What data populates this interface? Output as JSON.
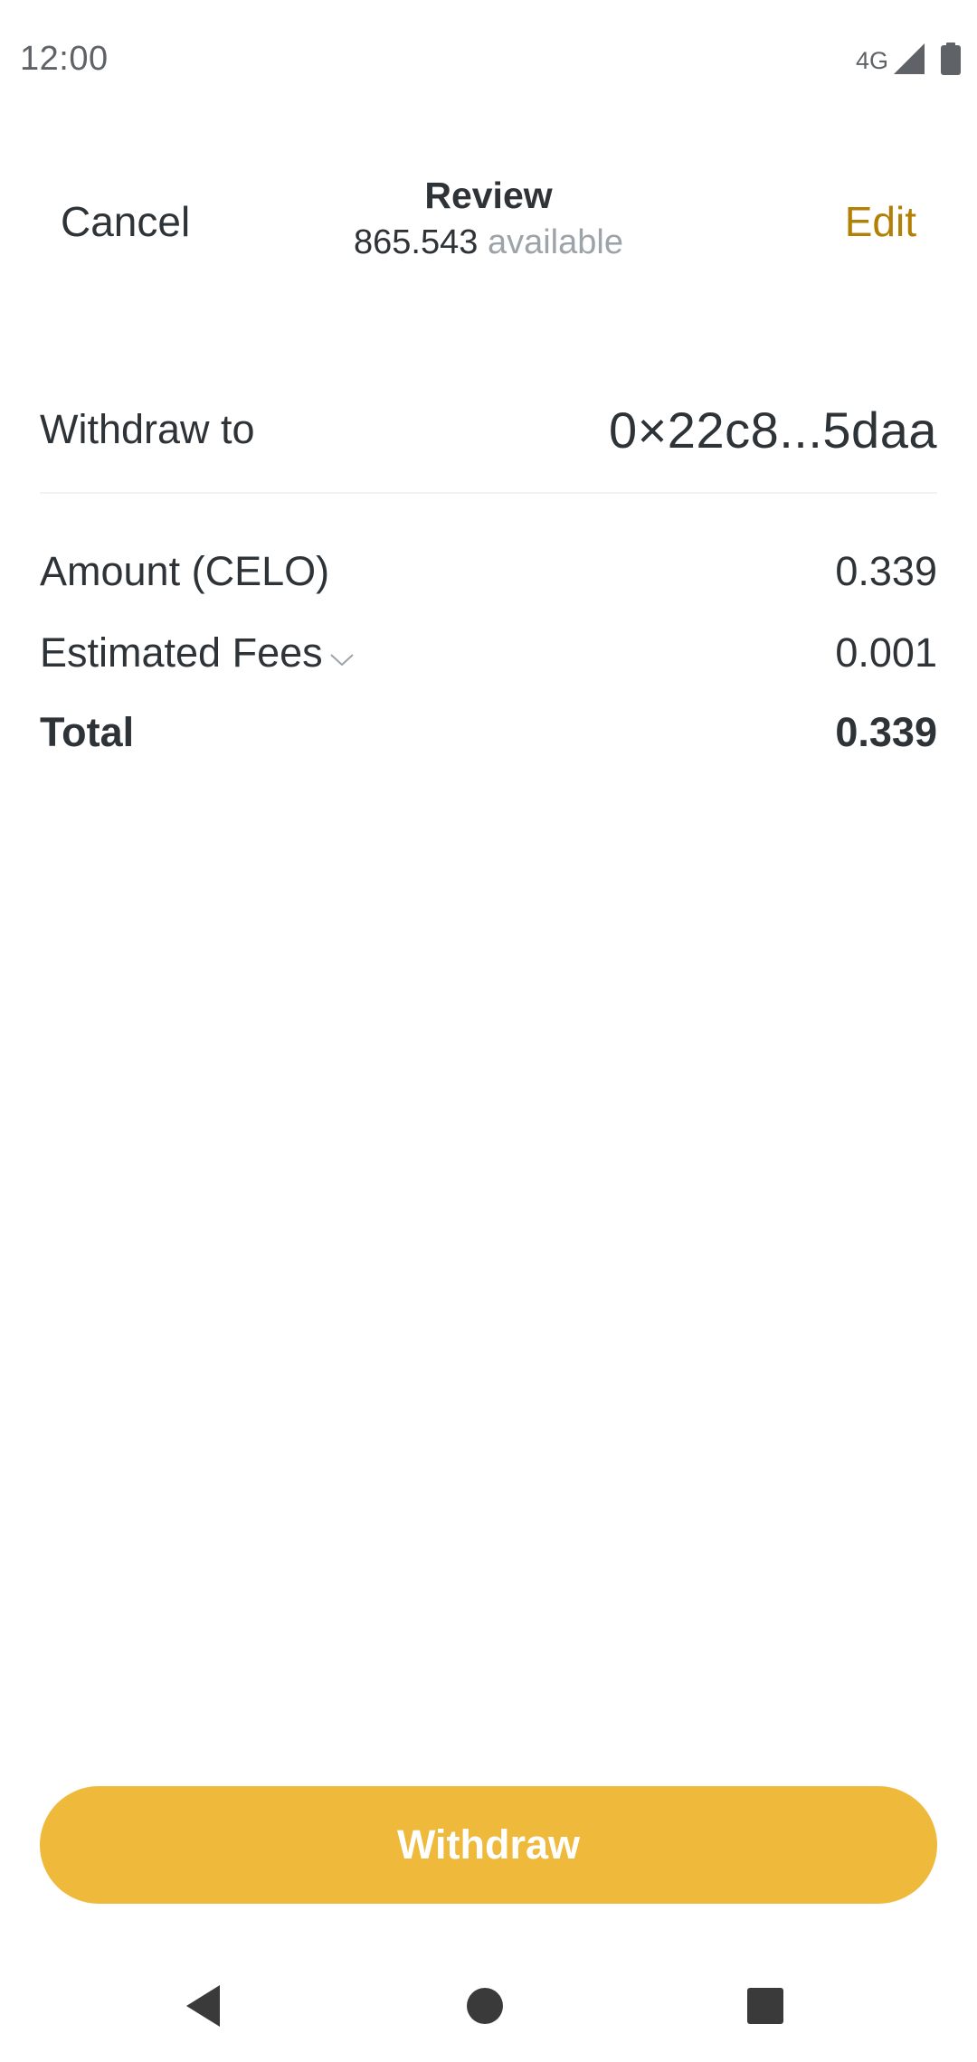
{
  "status_bar": {
    "time": "12:00",
    "network": "4G"
  },
  "header": {
    "cancel_label": "Cancel",
    "title": "Review",
    "available_amount": "865.543",
    "available_label": "available",
    "edit_label": "Edit"
  },
  "withdraw": {
    "label": "Withdraw to",
    "address": "0×22c8...5daa"
  },
  "summary": {
    "amount_label": "Amount (CELO)",
    "amount_value": "0.339",
    "fees_label": "Estimated Fees",
    "fees_value": "0.001",
    "total_label": "Total",
    "total_value": "0.339"
  },
  "action": {
    "withdraw_button_label": "Withdraw"
  },
  "colors": {
    "accent": "#efb93b",
    "edit_text": "#b38005",
    "text_primary": "#2e3338",
    "text_secondary": "#9ca4a9"
  },
  "icons": {
    "signal": "signal-icon",
    "battery": "battery-icon",
    "fees_toggle": "chevron-down-icon",
    "nav_back": "back-triangle-icon",
    "nav_home": "home-circle-icon",
    "nav_recents": "recents-square-icon"
  }
}
